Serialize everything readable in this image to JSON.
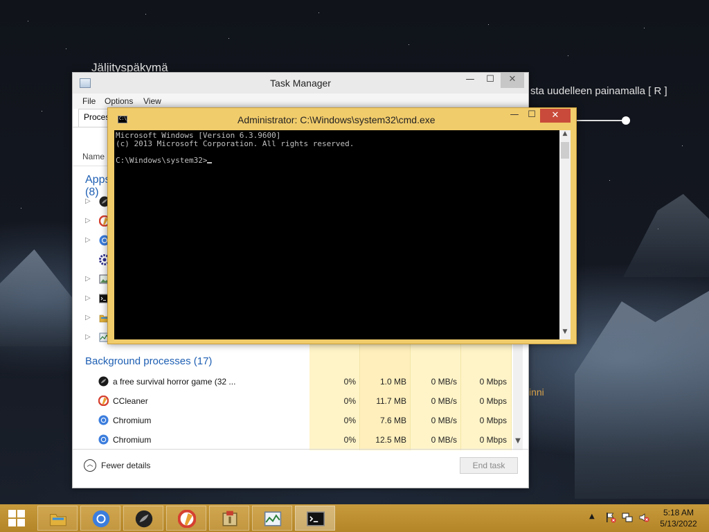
{
  "desktop": {
    "game_title": "Jäljityspäkymä",
    "game_hint": "sta uudelleen painamalla [ R ]",
    "game_fragment": "inni"
  },
  "task_manager": {
    "title": "Task Manager",
    "icon": "task-manager-icon",
    "window_buttons": {
      "minimize": "—",
      "maximize": "☐",
      "close": "✕"
    },
    "menu": {
      "file": "File",
      "options": "Options",
      "view": "View"
    },
    "tab_label": "Processes",
    "column_name": "Name",
    "apps_header": "Apps (8)",
    "app_rows": [
      {
        "icon": "game-icon",
        "color": "#222222"
      },
      {
        "icon": "ccleaner-icon",
        "color": "#d64030"
      },
      {
        "icon": "chromium-icon",
        "color": "#3b7ddd"
      },
      {
        "icon": "gear-icon",
        "color": "#2b2b8a"
      },
      {
        "icon": "image-viewer-icon",
        "color": "#5a8f5a"
      },
      {
        "icon": "cmd-icon",
        "color": "#111111"
      },
      {
        "icon": "file-explorer-icon",
        "color": "#e2b13c"
      },
      {
        "icon": "task-manager-icon",
        "color": "#6a7f99"
      }
    ],
    "background_header": "Background processes (17)",
    "background_processes": [
      {
        "name": "a free survival horror game (32 ...",
        "cpu": "0%",
        "memory": "1.0 MB",
        "disk": "0 MB/s",
        "network": "0 Mbps",
        "icon": "game-icon",
        "color": "#1a1a1a"
      },
      {
        "name": "CCleaner",
        "cpu": "0%",
        "memory": "11.7 MB",
        "disk": "0 MB/s",
        "network": "0 Mbps",
        "icon": "ccleaner-icon",
        "color": "#d64030"
      },
      {
        "name": "Chromium",
        "cpu": "0%",
        "memory": "7.6 MB",
        "disk": "0 MB/s",
        "network": "0 Mbps",
        "icon": "chromium-icon",
        "color": "#3b7ddd"
      },
      {
        "name": "Chromium",
        "cpu": "0%",
        "memory": "12.5 MB",
        "disk": "0 MB/s",
        "network": "0 Mbps",
        "icon": "chromium-icon",
        "color": "#3b7ddd"
      }
    ],
    "fewer_details_label": "Fewer details",
    "end_task_label": "End task"
  },
  "cmd": {
    "title": "Administrator: C:\\Windows\\system32\\cmd.exe",
    "icon_text": "C:\\_",
    "lines": [
      "Microsoft Windows [Version 6.3.9600]",
      "(c) 2013 Microsoft Corporation. All rights reserved."
    ],
    "prompt": "C:\\Windows\\system32>",
    "window_buttons": {
      "minimize": "—",
      "maximize": "☐",
      "close": "✕"
    }
  },
  "taskbar": {
    "pinned": [
      {
        "name": "file-explorer-icon"
      },
      {
        "name": "chromium-icon"
      },
      {
        "name": "game-icon"
      },
      {
        "name": "ccleaner-icon"
      },
      {
        "name": "archive-icon"
      },
      {
        "name": "task-manager-icon"
      },
      {
        "name": "cmd-icon",
        "active": true
      }
    ],
    "tray": {
      "chevron": "▲",
      "icons": [
        "action-center-flag-icon",
        "network-icon",
        "volume-muted-icon"
      ]
    },
    "clock": {
      "time": "5:18 AM",
      "date": "5/13/2022"
    }
  },
  "colors": {
    "accent_gold": "#f1cc6b",
    "taskbar": "#c79a3c",
    "link_blue": "#1e5fb3",
    "cmd_close_red": "#c94a3a"
  }
}
